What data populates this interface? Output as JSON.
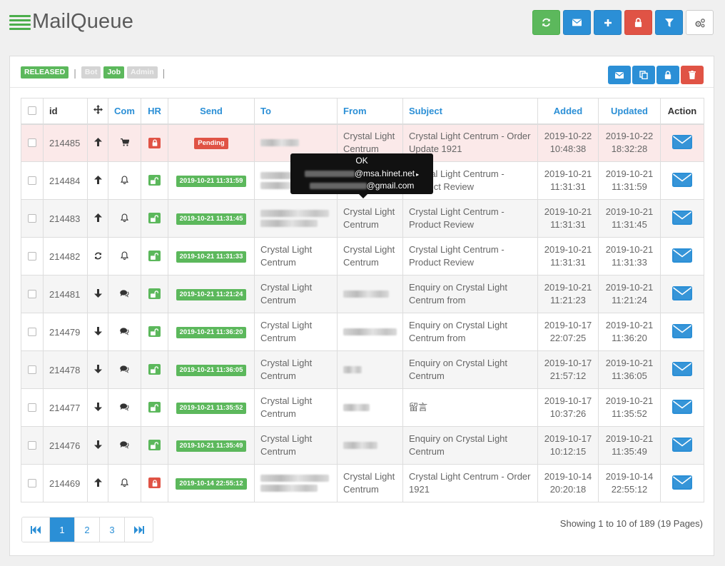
{
  "app": {
    "title": "MailQueue"
  },
  "header_buttons": [
    {
      "icon": "refresh-icon",
      "color": "#5cb85c"
    },
    {
      "icon": "envelope-icon",
      "color": "#2b8fd6"
    },
    {
      "icon": "plus-icon",
      "color": "#2b8fd6"
    },
    {
      "icon": "lock-icon",
      "color": "#e05345"
    },
    {
      "icon": "filter-icon",
      "color": "#2b8fd6"
    },
    {
      "icon": "gears-icon",
      "color": "#ffffff"
    }
  ],
  "filters": {
    "released": "RELEASED",
    "bot": "Bot",
    "job": "Job",
    "admin": "Admin",
    "separator": "|"
  },
  "columns": {
    "id": "id",
    "com": "Com",
    "hr": "HR",
    "send": "Send",
    "to": "To",
    "from": "From",
    "subject": "Subject",
    "added": "Added",
    "updated": "Updated",
    "action": "Action"
  },
  "rows": [
    {
      "id": "214485",
      "dir": "up",
      "com": "cart",
      "hr": "locked",
      "send": "Pending",
      "to": "",
      "from": "Crystal Light Centrum",
      "subject": "Crystal Light Centrum - Order Update 1921",
      "added_date": "2019-10-22",
      "added_time": "10:48:38",
      "updated_date": "2019-10-22",
      "updated_time": "18:32:28"
    },
    {
      "id": "214484",
      "dir": "up",
      "com": "bell",
      "hr": "unlocked",
      "send": "2019-10-21 11:31:59",
      "to": "",
      "from": "",
      "subject": "Crystal Light Centrum - Product Review",
      "added_date": "2019-10-21",
      "added_time": "11:31:31",
      "updated_date": "2019-10-21",
      "updated_time": "11:31:59"
    },
    {
      "id": "214483",
      "dir": "up",
      "com": "bell",
      "hr": "unlocked",
      "send": "2019-10-21 11:31:45",
      "to": "",
      "from": "Crystal Light Centrum",
      "subject": "Crystal Light Centrum - Product Review",
      "added_date": "2019-10-21",
      "added_time": "11:31:31",
      "updated_date": "2019-10-21",
      "updated_time": "11:31:45"
    },
    {
      "id": "214482",
      "dir": "sync",
      "com": "bell",
      "hr": "unlocked",
      "send": "2019-10-21 11:31:33",
      "to": "Crystal Light Centrum",
      "from": "Crystal Light Centrum",
      "subject": "Crystal Light Centrum - Product Review",
      "added_date": "2019-10-21",
      "added_time": "11:31:31",
      "updated_date": "2019-10-21",
      "updated_time": "11:31:33"
    },
    {
      "id": "214481",
      "dir": "down",
      "com": "comments",
      "hr": "unlocked",
      "send": "2019-10-21 11:21:24",
      "to": "Crystal Light Centrum",
      "from": "",
      "subject": "Enquiry on Crystal Light Centrum from",
      "added_date": "2019-10-21",
      "added_time": "11:21:23",
      "updated_date": "2019-10-21",
      "updated_time": "11:21:24"
    },
    {
      "id": "214479",
      "dir": "down",
      "com": "comments",
      "hr": "unlocked",
      "send": "2019-10-21 11:36:20",
      "to": "Crystal Light Centrum",
      "from": "",
      "subject": "Enquiry on Crystal Light Centrum from",
      "added_date": "2019-10-17",
      "added_time": "22:07:25",
      "updated_date": "2019-10-21",
      "updated_time": "11:36:20"
    },
    {
      "id": "214478",
      "dir": "down",
      "com": "comments",
      "hr": "unlocked",
      "send": "2019-10-21 11:36:05",
      "to": "Crystal Light Centrum",
      "from": "",
      "subject": "Enquiry on Crystal Light Centrum",
      "added_date": "2019-10-17",
      "added_time": "21:57:12",
      "updated_date": "2019-10-21",
      "updated_time": "11:36:05"
    },
    {
      "id": "214477",
      "dir": "down",
      "com": "comments",
      "hr": "unlocked",
      "send": "2019-10-21 11:35:52",
      "to": "Crystal Light Centrum",
      "from": "",
      "subject": "留言",
      "added_date": "2019-10-17",
      "added_time": "10:37:26",
      "updated_date": "2019-10-21",
      "updated_time": "11:35:52"
    },
    {
      "id": "214476",
      "dir": "down",
      "com": "comments",
      "hr": "unlocked",
      "send": "2019-10-21 11:35:49",
      "to": "Crystal Light Centrum",
      "from": "",
      "subject": "Enquiry on Crystal Light Centrum",
      "added_date": "2019-10-17",
      "added_time": "10:12:15",
      "updated_date": "2019-10-21",
      "updated_time": "11:35:49"
    },
    {
      "id": "214469",
      "dir": "up",
      "com": "bell",
      "hr": "locked",
      "send": "2019-10-14 22:55:12",
      "to": "",
      "from": "Crystal Light Centrum",
      "subject": "Crystal Light Centrum - Order 1921",
      "added_date": "2019-10-14",
      "added_time": "20:20:18",
      "updated_date": "2019-10-14",
      "updated_time": "22:55:12"
    }
  ],
  "tooltip": {
    "line1": "OK",
    "line2": "@msa.hinet.net",
    "line3": "@gmail.com"
  },
  "pagination": {
    "pages": [
      "1",
      "2",
      "3"
    ],
    "current": "1",
    "summary": "Showing 1 to 10 of 189 (19 Pages)"
  }
}
